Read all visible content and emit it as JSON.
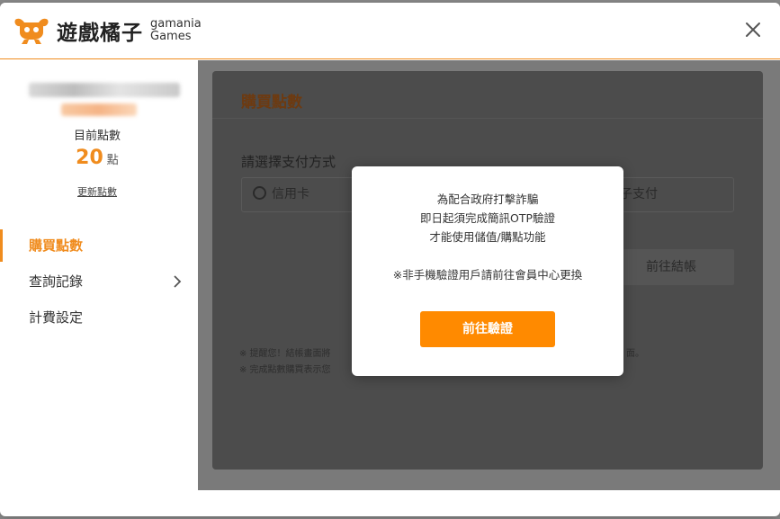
{
  "window": {
    "close_icon": "close-icon"
  },
  "logo": {
    "cn": "遊戲橘子",
    "en_line1": "gamania",
    "en_line2": "Games"
  },
  "sidebar": {
    "points_label": "目前點數",
    "points_value": "20",
    "points_unit": "點",
    "refresh_label": "更新點數",
    "nav": [
      {
        "label": "購買點數",
        "active": true
      },
      {
        "label": "查詢記錄",
        "icon": "chevron-right-icon"
      },
      {
        "label": "計費設定"
      }
    ]
  },
  "panel": {
    "title": "購買點數",
    "payment_label": "請選擇支付方式",
    "option_left": "信用卡",
    "option_right": "子支付",
    "checkout_label": "前往結帳",
    "note1": "※ 提醒您！結帳畫面將",
    "note2": "※ 完成點數購買表示您",
    "note_tail": "面。"
  },
  "modal": {
    "line1": "為配合政府打擊詐騙",
    "line2": "即日起須完成簡訊OTP驗證",
    "line3": "才能使用儲值/購點功能",
    "line4": "※非手機驗證用戶請前往會員中心更換",
    "button_label": "前往驗證"
  },
  "colors": {
    "accent": "#f08c1e",
    "button": "#ff8a00"
  }
}
